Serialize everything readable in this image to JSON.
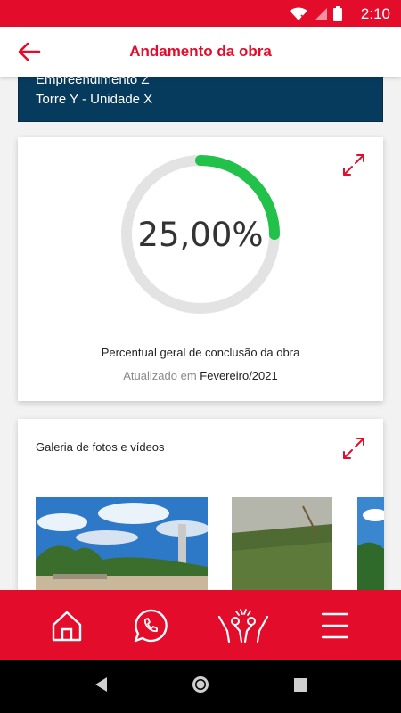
{
  "status_bar": {
    "time": "2:10",
    "icons": [
      "wifi-icon",
      "signal-icon",
      "battery-icon"
    ]
  },
  "app_bar": {
    "title": "Andamento da obra",
    "back_icon": "arrow-left-icon"
  },
  "project": {
    "line1": "Empreendimento Z",
    "line2": "Torre Y - Unidade X"
  },
  "progress": {
    "value_text": "25,00%",
    "fraction": 0.25,
    "caption": "Percentual geral de conclusão da obra",
    "updated_prefix": "Atualizado em",
    "updated_month": "Fevereiro/2021",
    "expand_icon": "expand-icon"
  },
  "gallery": {
    "title": "Galeria de fotos e vídeos",
    "expand_icon": "expand-icon",
    "photo_count_visible": 3
  },
  "bottom_nav": {
    "items": [
      "home-icon",
      "whatsapp-icon",
      "community-icon",
      "menu-icon"
    ]
  },
  "system_nav": {
    "items": [
      "back-triangle-icon",
      "home-circle-icon",
      "recents-square-icon"
    ]
  },
  "colors": {
    "brand": "#e30c2b",
    "navy": "#073b5e",
    "progress": "#22c24a",
    "track": "#e3e3e3"
  }
}
